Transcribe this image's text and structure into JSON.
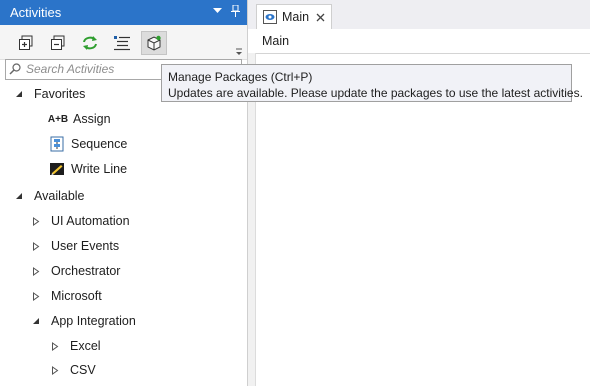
{
  "activities_panel": {
    "title": "Activities",
    "search_placeholder": "Search Activities",
    "toolbar": {
      "expand_all": "expand-all-icon",
      "collapse_all": "collapse-all-icon",
      "refresh": "refresh-icon",
      "show_categories": "categories-icon",
      "manage_packages": "manage-packages-icon"
    },
    "tree": {
      "favorites": {
        "label": "Favorites",
        "items": [
          "Assign",
          "Sequence",
          "Write Line"
        ],
        "assign_icon_text": "A+B"
      },
      "available": {
        "label": "Available",
        "items": [
          "UI Automation",
          "User Events",
          "Orchestrator",
          "Microsoft"
        ],
        "app_integration": {
          "label": "App Integration",
          "items": [
            "Excel",
            "CSV"
          ]
        }
      }
    }
  },
  "designer": {
    "tab_label": "Main",
    "breadcrumb": "Main"
  },
  "tooltip": {
    "title": "Manage Packages (Ctrl+P)",
    "message": "Updates are available. Please update the packages to use the latest activities."
  },
  "colors": {
    "title_bar": "#2b74c9",
    "green_refresh": "#2f9e2f"
  }
}
